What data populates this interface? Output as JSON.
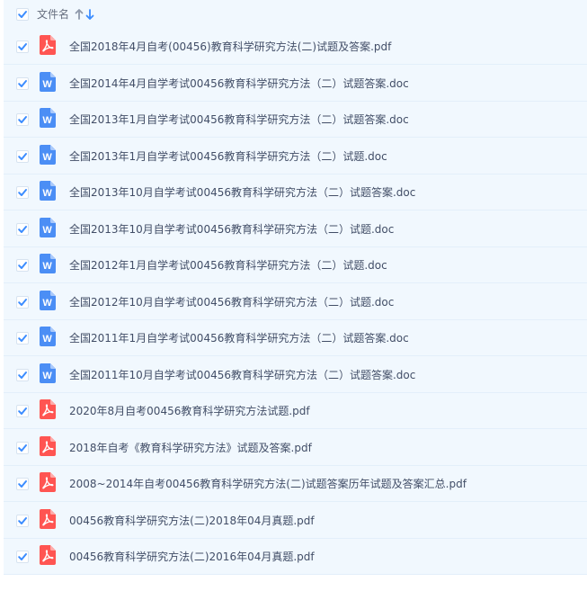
{
  "header": {
    "column_label": "文件名",
    "select_all_checked": true,
    "sort_icons": [
      "arrow-up-icon",
      "arrow-down-icon"
    ]
  },
  "colors": {
    "list_bg": "#f1f8fe",
    "checkbox_check": "#3b8cff",
    "pdf_icon": "#ff5552",
    "doc_icon": "#4b8ef5",
    "sort_up": "#8e99ab",
    "sort_down": "#3b8cff"
  },
  "files": [
    {
      "name": "全国2018年4月自考(00456)教育科学研究方法(二)试题及答案.pdf",
      "type": "pdf",
      "checked": true
    },
    {
      "name": "全国2014年4月自学考试00456教育科学研究方法（二）试题答案.doc",
      "type": "doc",
      "checked": true
    },
    {
      "name": "全国2013年1月自学考试00456教育科学研究方法（二）试题答案.doc",
      "type": "doc",
      "checked": true
    },
    {
      "name": "全国2013年1月自学考试00456教育科学研究方法（二）试题.doc",
      "type": "doc",
      "checked": true
    },
    {
      "name": "全国2013年10月自学考试00456教育科学研究方法（二）试题答案.doc",
      "type": "doc",
      "checked": true
    },
    {
      "name": "全国2013年10月自学考试00456教育科学研究方法（二）试题.doc",
      "type": "doc",
      "checked": true
    },
    {
      "name": "全国2012年1月自学考试00456教育科学研究方法（二）试题.doc",
      "type": "doc",
      "checked": true
    },
    {
      "name": "全国2012年10月自学考试00456教育科学研究方法（二）试题.doc",
      "type": "doc",
      "checked": true
    },
    {
      "name": "全国2011年1月自学考试00456教育科学研究方法（二）试题答案.doc",
      "type": "doc",
      "checked": true
    },
    {
      "name": "全国2011年10月自学考试00456教育科学研究方法（二）试题答案.doc",
      "type": "doc",
      "checked": true
    },
    {
      "name": "2020年8月自考00456教育科学研究方法试题.pdf",
      "type": "pdf",
      "checked": true
    },
    {
      "name": "2018年自考《教育科学研究方法》试题及答案.pdf",
      "type": "pdf",
      "checked": true
    },
    {
      "name": "2008~2014年自考00456教育科学研究方法(二)试题答案历年试题及答案汇总.pdf",
      "type": "pdf",
      "checked": true
    },
    {
      "name": "00456教育科学研究方法(二)2018年04月真题.pdf",
      "type": "pdf",
      "checked": true
    },
    {
      "name": "00456教育科学研究方法(二)2016年04月真题.pdf",
      "type": "pdf",
      "checked": true
    }
  ]
}
